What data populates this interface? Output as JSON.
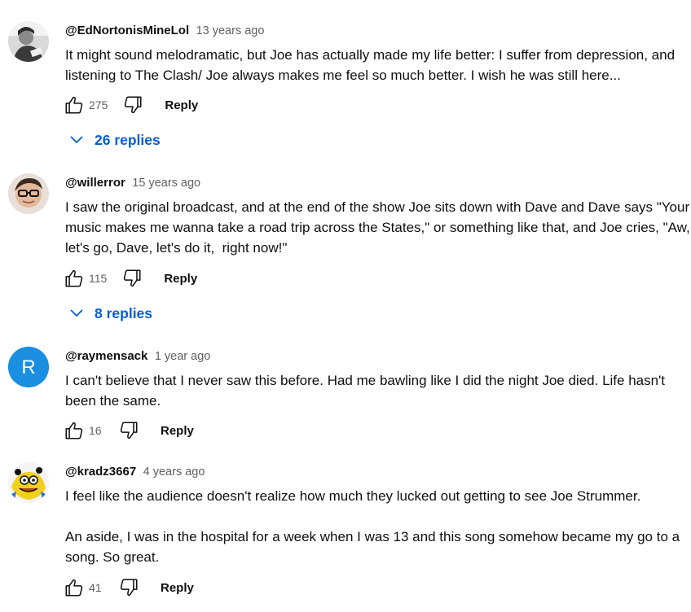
{
  "colors": {
    "link_blue": "#065fd4",
    "meta_gray": "#606060",
    "text": "#0f0f0f",
    "avatar_r_bg": "#1a8ee0"
  },
  "comments": [
    {
      "author": "@EdNortonisMineLol",
      "time": "13 years ago",
      "text": "It might sound melodramatic, but Joe has actually made my life better: I suffer from depression, and listening to The Clash/ Joe always makes me feel so much better. I wish he was still here...",
      "likes": "275",
      "reply_label": "Reply",
      "replies_label": "26 replies",
      "avatar_icon": "user-photo-icon"
    },
    {
      "author": "@willerror",
      "time": "15 years ago",
      "text": "I saw the original broadcast, and at the end of the show Joe sits down with Dave and Dave says \"Your music makes me wanna take a road trip across the States,\" or something like that, and Joe cries, \"Aw, let's go, Dave, let's do it,  right now!\"",
      "likes": "115",
      "reply_label": "Reply",
      "replies_label": "8 replies",
      "avatar_icon": "user-photo-icon"
    },
    {
      "author": "@raymensack",
      "time": "1 year ago",
      "text": "I can't believe that I never saw this before. Had me bawling like I did the night Joe died. Life hasn't been the same.",
      "likes": "16",
      "reply_label": "Reply",
      "avatar_letter": "R",
      "avatar_icon": "letter-avatar-icon"
    },
    {
      "author": "@kradz3667",
      "time": "4 years ago",
      "text": "I feel like the audience doesn't realize how much they lucked out getting to see Joe Strummer.\n\nAn aside, I was in the hospital for a week when I was 13 and this song somehow became my go to a song. So great.",
      "likes": "41",
      "reply_label": "Reply",
      "avatar_icon": "cartoon-avatar-icon"
    }
  ]
}
